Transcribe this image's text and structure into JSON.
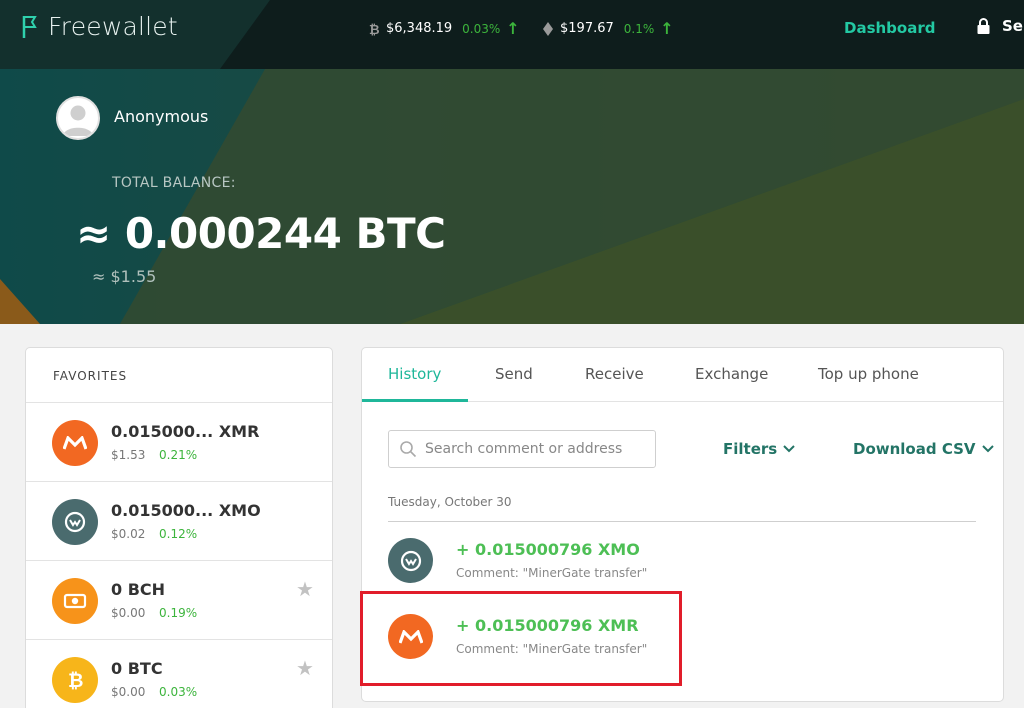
{
  "app": {
    "name": "Freewallet"
  },
  "ticker": [
    {
      "icon": "bitcoin-icon",
      "price": "$6,348.19",
      "change": "0.03%",
      "arrow": "↑"
    },
    {
      "icon": "ethereum-icon",
      "price": "$197.67",
      "change": "0.1%",
      "arrow": "↑"
    }
  ],
  "nav": {
    "dashboard": "Dashboard",
    "security": "Se"
  },
  "user": {
    "name": "Anonymous"
  },
  "balance": {
    "label": "TOTAL BALANCE:",
    "btc": "≈ 0.000244 BTC",
    "usd": "≈  $1.55"
  },
  "favorites": {
    "title": "FAVORITES",
    "items": [
      {
        "amount": "0.015000... XMR",
        "usd": "$1.53",
        "change": "0.21%",
        "icon": "monero-icon",
        "color": "#f26822"
      },
      {
        "amount": "0.015000... XMO",
        "usd": "$0.02",
        "change": "0.12%",
        "icon": "monero-original-icon",
        "color": "#4a6b6e"
      },
      {
        "amount": "0 BCH",
        "usd": "$0.00",
        "change": "0.19%",
        "icon": "bitcoin-cash-icon",
        "color": "#f7931a",
        "star": "★"
      },
      {
        "amount": "0 BTC",
        "usd": "$0.00",
        "change": "0.03%",
        "icon": "bitcoin-icon",
        "color": "#f7b51a",
        "star": "★"
      }
    ]
  },
  "tabs": [
    {
      "label": "History",
      "active": true
    },
    {
      "label": "Send"
    },
    {
      "label": "Receive"
    },
    {
      "label": "Exchange"
    },
    {
      "label": "Top up phone"
    }
  ],
  "search": {
    "placeholder": "Search comment or address"
  },
  "filters_label": "Filters",
  "download_label": "Download CSV",
  "history": {
    "date": "Tuesday, October 30",
    "transactions": [
      {
        "amount": "+ 0.015000796 XMO",
        "comment": "Comment: \"MinerGate transfer\"",
        "icon": "monero-original-icon",
        "color": "#4a6b6e"
      },
      {
        "amount": "+ 0.015000796 XMR",
        "comment": "Comment: \"MinerGate transfer\"",
        "icon": "monero-icon",
        "color": "#f26822"
      }
    ]
  },
  "colors": {
    "accent": "#1fb79a",
    "positive": "#4dbf55",
    "highlight": "#e11d2a"
  }
}
